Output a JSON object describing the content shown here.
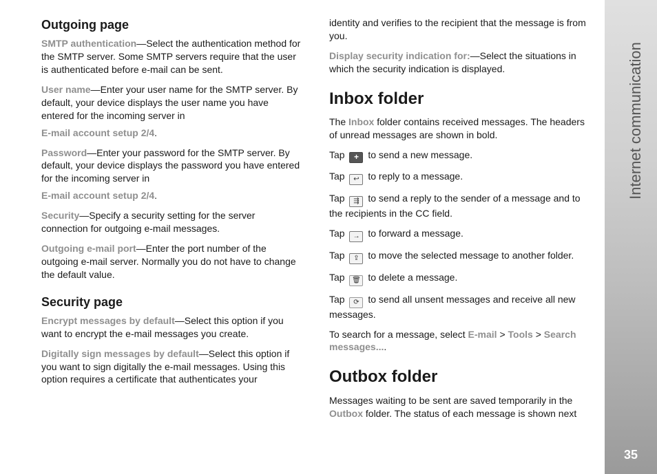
{
  "side": {
    "label": "Internet communication",
    "page_number": "35"
  },
  "col1": {
    "h_outgoing": "Outgoing page",
    "p1a": "SMTP authentication",
    "p1b": "—Select the authentication method for the SMTP server. Some SMTP servers require that the user is authenticated before e-mail can be sent.",
    "p2a": "User name",
    "p2b": "—Enter your user name for the SMTP server. By default, your device displays the user name you have entered for the incoming server in",
    "p2c": "E-mail account setup 2/4",
    "p2d": ".",
    "p3a": "Password",
    "p3b": "—Enter your password for the SMTP server. By default, your device displays the password you have entered for the incoming server in",
    "p3c": "E-mail account setup 2/4",
    "p3d": ".",
    "p4a": "Security",
    "p4b": "—Specify a security setting for the server connection for outgoing e-mail messages.",
    "p5a": "Outgoing e-mail port",
    "p5b": "—Enter the port number of the outgoing e-mail server. Normally you do not have to change the default value.",
    "h_security": "Security page",
    "p6a": "Encrypt messages by default",
    "p6b": "—Select this option if you want to encrypt the e-mail messages you create.",
    "p7a": "Digitally sign messages by default",
    "p7b": "—Select this option if you want to sign digitally the e-mail messages. Using this option requires a certificate that authenticates your"
  },
  "col2": {
    "p0": "identity and verifies to the recipient that the message is from you.",
    "p1a": "Display security indication for:",
    "p1b": "—Select the situations in which the security indication is displayed.",
    "h_inbox": "Inbox folder",
    "p2a": "The ",
    "p2b": "Inbox",
    "p2c": " folder contains received messages. The headers of unread messages are shown in bold.",
    "tap": "Tap ",
    "i_new": "+",
    "t_new": " to send a new message.",
    "i_reply": "↩",
    "t_reply": " to reply to a message.",
    "i_replyall": "⇶",
    "t_replyall": " to send a reply to the sender of a message and to the recipients in the CC field.",
    "i_forward": "→",
    "t_forward": " to forward a message.",
    "i_move": "⇪",
    "t_move": " to move the selected message to another folder.",
    "i_delete": "🗑",
    "t_delete": " to delete a message.",
    "i_sync": "⟳",
    "t_sync": " to send all unsent messages and receive all new messages.",
    "p3a": "To search for a message, select ",
    "p3b": "E-mail",
    "p3c": " > ",
    "p3d": "Tools",
    "p3e": " > ",
    "p3f": "Search messages...",
    "p3g": ".",
    "h_outbox": "Outbox folder",
    "p4a": "Messages waiting to be sent are saved temporarily in the ",
    "p4b": "Outbox",
    "p4c": " folder. The status of each message is shown next"
  }
}
